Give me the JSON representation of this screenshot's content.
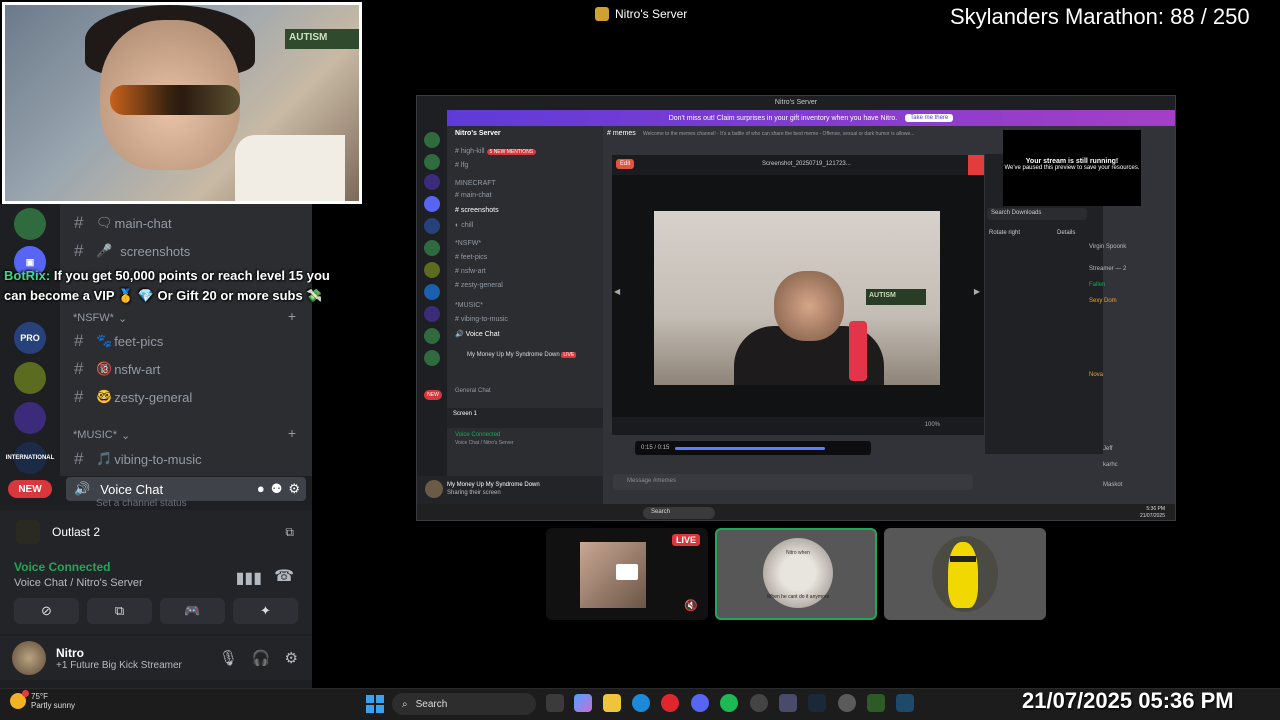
{
  "top": {
    "window_title": "Nitro's Server",
    "marathon_label": "Skylanders Marathon:",
    "marathon_progress": "88 / 250"
  },
  "webcam": {
    "sign_text": "AUTISM"
  },
  "left": {
    "server_rail": [
      "PRO",
      "",
      "",
      "INTERNATIONAL"
    ],
    "channels": [
      {
        "icon": "🗨",
        "name": "main-chat"
      },
      {
        "icon": "🎤",
        "name": "screenshots"
      }
    ],
    "categories": {
      "nsfw": "*NSFW*",
      "music": "*MUSIC*"
    },
    "nsfw_channels": [
      {
        "icon": "🐾",
        "name": "feet-pics"
      },
      {
        "icon": "🔞",
        "name": "nsfw-art"
      },
      {
        "icon": "🤓",
        "name": "zesty-general"
      }
    ],
    "music_channels": [
      {
        "icon": "🎵",
        "name": "vibing-to-music"
      }
    ],
    "voice_channel": "Voice Chat",
    "voice_status": "Set a channel status",
    "new_pill": "NEW",
    "botrix": {
      "name": "BotRix:",
      "message": "If you get 50,000 points or reach level 15 you can become a VIP 🥇 💎 Or Gift 20 or more subs 💸"
    },
    "activity": "Outlast 2",
    "voice_connected": "Voice Connected",
    "voice_location": "Voice Chat / Nitro's Server",
    "user": {
      "name": "Nitro",
      "status": "Future Big Kick Streamer",
      "boost": "+1"
    }
  },
  "stream": {
    "window_title": "Nitro's Server",
    "banner": "Don't miss out! Claim surprises in your gift inventory when you have Nitro.",
    "banner_button": "Take me there",
    "server_name": "Nitro's Server",
    "channels": [
      {
        "name": "high-kill",
        "badge": "5 NEW MENTIONS"
      },
      {
        "name": "lfg"
      },
      {
        "name": "MINECRAFT"
      },
      {
        "name": "main-chat"
      },
      {
        "name": "screenshots"
      },
      {
        "name": "chill"
      },
      {
        "name": "*NSFW*"
      },
      {
        "name": "feet-pics"
      },
      {
        "name": "nsfw-art"
      },
      {
        "name": "zesty-general"
      },
      {
        "name": "*MUSIC*"
      },
      {
        "name": "vibing-to-music"
      },
      {
        "name": "Voice Chat"
      },
      {
        "name": "My Money Up My Syndrome Down",
        "badge": "LIVE"
      },
      {
        "name": "General Chat"
      }
    ],
    "channel_header": "memes",
    "channel_topic": "Welcome to the memes channel! - It's a battle of who can share the best meme - Offense, sexual or dark humor is allowe...",
    "viewer_edit": "Edit",
    "viewer_filename": "Screenshot_20250719_121723...",
    "viewer_time": "0:15 / 0:15",
    "viewer_zoom": "100%",
    "photo_sign": "AUTISM",
    "popup_title": "Your stream is still running!",
    "popup_body": "We've paused this preview to save your resources.",
    "downloads_search": "Search Downloads",
    "downloads_rotate": "Rotate right",
    "downloads_details": "Details",
    "members": [
      "Virgin Spoonk",
      "Streamer — 2",
      "Fallen",
      "Sexy Dom",
      "Nova",
      "Jeff",
      "karhc",
      "Maskot"
    ],
    "message_placeholder": "Message #memes",
    "screen_label": "Screen 1",
    "voice_connected": "Voice Connected",
    "voice_location": "Voice Chat / Nitro's Server",
    "user_activity": "My Money Up My Syndrome Down",
    "user_activity_sub": "Sharing their screen",
    "taskbar_search": "Search",
    "taskbar_time": "5:36 PM",
    "taskbar_date": "21/07/2025"
  },
  "tiles": {
    "live_label": "LIVE",
    "tile2_caption_top": "Nitro when",
    "tile2_caption_bottom": "When he cant do it anymore"
  },
  "taskbar": {
    "weather_temp": "75°F",
    "weather_desc": "Partly sunny",
    "search": "Search",
    "datetime": "21/07/2025 05:36 PM"
  }
}
